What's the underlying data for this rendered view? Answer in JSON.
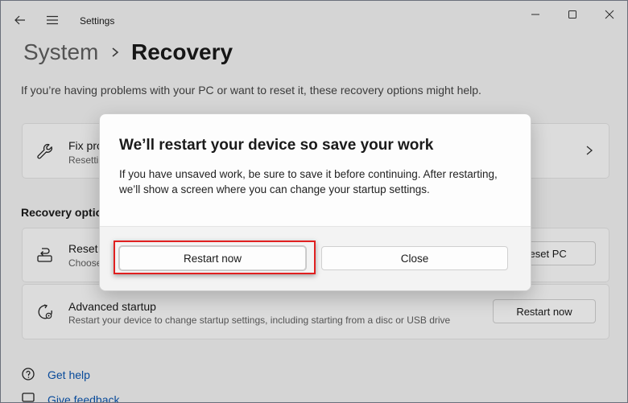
{
  "window": {
    "title": "Settings"
  },
  "breadcrumb": {
    "parent": "System",
    "current": "Recovery"
  },
  "intro": "If you’re having problems with your PC or want to reset it, these recovery options might help.",
  "cards": {
    "fix": {
      "title": "Fix pro",
      "subtitle": "Resettin"
    },
    "section_label": "Recovery options",
    "reset": {
      "title": "Reset",
      "subtitle": "Choose",
      "button": "Reset PC"
    },
    "advanced": {
      "title": "Advanced startup",
      "subtitle": "Restart your device to change startup settings, including starting from a disc or USB drive",
      "button": "Restart now"
    }
  },
  "links": {
    "help": "Get help",
    "feedback": "Give feedback"
  },
  "dialog": {
    "title": "We’ll restart your device so save your work",
    "body": "If you have unsaved work, be sure to save it before continuing. After restarting, we’ll show a screen where you can change your startup settings.",
    "primary_button": "Restart now",
    "secondary_button": "Close"
  },
  "icons": {
    "back": "back-arrow-icon",
    "menu": "hamburger-menu-icon",
    "minimize": "minimize-icon",
    "maximize": "maximize-icon",
    "close": "close-icon",
    "fix": "wrench-icon",
    "reset": "reset-pc-icon",
    "advanced": "advanced-startup-icon",
    "help": "help-icon",
    "feedback": "feedback-icon"
  },
  "colors": {
    "accent_link": "#0a55b0",
    "highlight": "#e02020"
  }
}
